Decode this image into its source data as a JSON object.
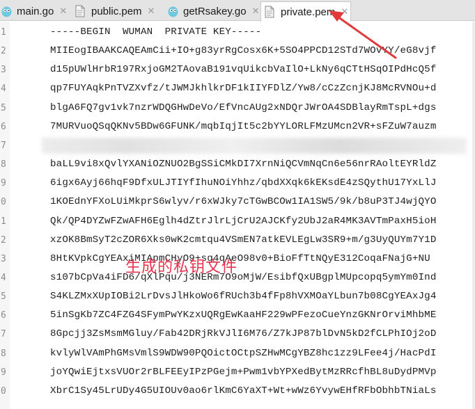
{
  "tabs": [
    {
      "label": "main.go",
      "icon": "go-gopher-icon"
    },
    {
      "label": "public.pem",
      "icon": "pem-file-icon"
    },
    {
      "label": "getRsakey.go",
      "icon": "go-gopher-icon"
    },
    {
      "label": "private.pem",
      "icon": "pem-file-icon"
    }
  ],
  "lines": [
    {
      "num": "1",
      "text": "-----BEGIN  WUMAN  PRIVATE KEY-----"
    },
    {
      "num": "2",
      "text": "MIIEogIBAAKCAQEAmCii+IO+g83yrRgCosx6K+5SO4PPCD12STd7WOvYY/eG8vjf"
    },
    {
      "num": "3",
      "text": "d15pUWlHrbR197RxjoGM2TAovaB191vqUikcbVaIlO+LkNy6qCTtHSqOIPdHcQ5f"
    },
    {
      "num": "4",
      "text": "qp7FUYAqkPnTVZXvfz/tJWMJkhlkrDF1kIIYFDlZ/Yw8/cCzZcnjKJ8McRVNOu+d"
    },
    {
      "num": "5",
      "text": "blgA6FQ7gv1vk7nzrWDQGHwDeVo/EfVncAUg2xNDQrJWrOA4SDBlayRmTspL+dgs"
    },
    {
      "num": "6",
      "text": "7MURVuoQSqQKNv5BDw6GFUNK/mqbIqjIt5c2bYYLORLFMzUMcn2VR+sFZuW7auzm"
    },
    {
      "num": "7",
      "text": ""
    },
    {
      "num": "8",
      "text": "baLL9vi8xQvlYXANiOZNUO2BgSSiCMkDI7XrnNiQCVmNqCn6e56nrRAoltEYRldZ"
    },
    {
      "num": "9",
      "text": "6igx6Ayj66hqF9DfxULJTIYfIhuNOiYhhz/qbdXXqk6kEKsdE4zSQythU17YxLlJ"
    },
    {
      "num": "0",
      "text": "1KOEdnYFXoLUiMkprS6wlyv/r6xWJky7cTGwBCOw1IA1SW5/9k/b8uP3TJ4wjQYO"
    },
    {
      "num": "1",
      "text": "Qk/QP4DYZwFZwAFH6Eglh4dZtrJlrLjCrU2AJCKfy2UbJ2aR4MK3AVTmPaxH5ioH"
    },
    {
      "num": "2",
      "text": "xzOK8BmSyT2cZOR6Xks0wK2cmtqu4VSmEN7atkEVLEgLw3SR9+m/g3UyQUYm7Y1D"
    },
    {
      "num": "3",
      "text": "8HtKVpkCgYEAxiMIApmCHyO9+sg4qAeO98v0+BioFfTtNQyE312CoqaFNajG+NU"
    },
    {
      "num": "4",
      "text": "s107bCpVa4iFD6/qXlPqu/j3NERm7O9oMjW/EsibfQxUBgplMUpcopq5ymYm0Ind"
    },
    {
      "num": "5",
      "text": "S4KLZMxXUpIOBi2LrDvsJlHkoWo6fRUch3b4fFp8hVXMOaYLbun7b08CgYEAxJg4"
    },
    {
      "num": "6",
      "text": "5inSgKb7ZC4FZG4SFymPwYKzxUQRgEwKaaHF229wPFezoCueYnzGKNrOrviMhbME"
    },
    {
      "num": "7",
      "text": "8Gpcjj3ZsMsmMGluy/Fab42DRjRkVJlI6M76/Z7kJP87blDvN5kD2fCLPhIOj2oD"
    },
    {
      "num": "8",
      "text": "kvlyWlVAmPhGMsVmlS9WDW90PQOictOCtpSZHwMCgYBZ8hc1zz9LFee4j/HacPdI"
    },
    {
      "num": "9",
      "text": "joYQwiEjtxsVUOr2rBLFEEyIPzPGejm+Pwm1vbYPXedBytMzRRcfhBL8uDydPMVp"
    },
    {
      "num": "0",
      "text": "XbrC1Sy45LrUDy4G5UIOUv0ao6rlKmC6YaXT+Wt+wWz6YvywEHfRFbObhbTNiaLs"
    }
  ],
  "annotation": "生成的私钥文件",
  "colors": {
    "annotation": "#e8334f",
    "arrow": "#e03a3a"
  }
}
